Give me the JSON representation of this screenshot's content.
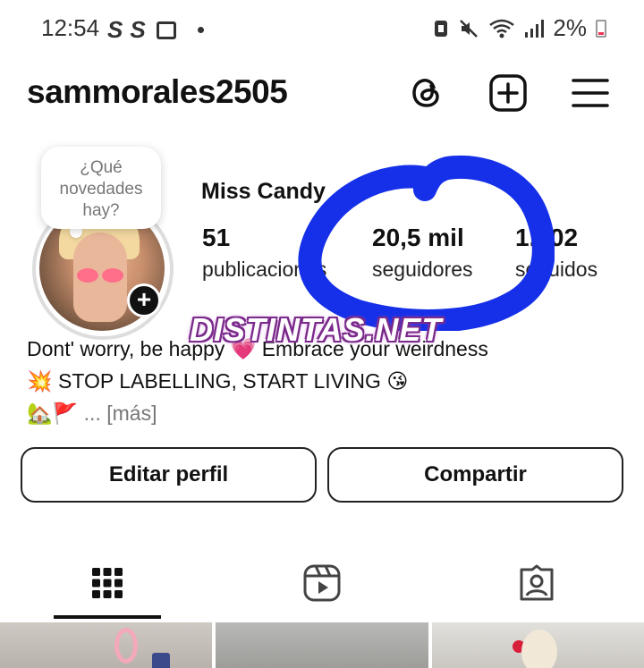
{
  "status_bar": {
    "time": "12:54",
    "app_icons": [
      "S",
      "S"
    ],
    "battery": "2%"
  },
  "header": {
    "username": "sammorales2505",
    "icons": [
      "threads-icon",
      "create-post-icon",
      "menu-icon"
    ]
  },
  "profile": {
    "note_bubble": "¿Qué novedades hay?",
    "display_name": "Miss Candy",
    "stats": [
      {
        "value": "51",
        "label": "publicaciones"
      },
      {
        "value": "20,5 mil",
        "label": "seguidores"
      },
      {
        "value": "1.202",
        "label": "seguidos"
      }
    ],
    "bio": {
      "line1": "Dont' worry, be happy 💗 Embrace your weirdness",
      "line2": "💥 STOP LABELLING, START LIVING 😘",
      "line3_emoji": "🏡🚩",
      "more": "... [más]"
    }
  },
  "actions": {
    "edit_profile": "Editar perfil",
    "share": "Compartir"
  },
  "tabs": [
    "grid-icon",
    "reels-icon",
    "tagged-icon"
  ],
  "overlay": {
    "watermark": "DISTINTAS.NET",
    "scribble_color": "#1530e8"
  }
}
